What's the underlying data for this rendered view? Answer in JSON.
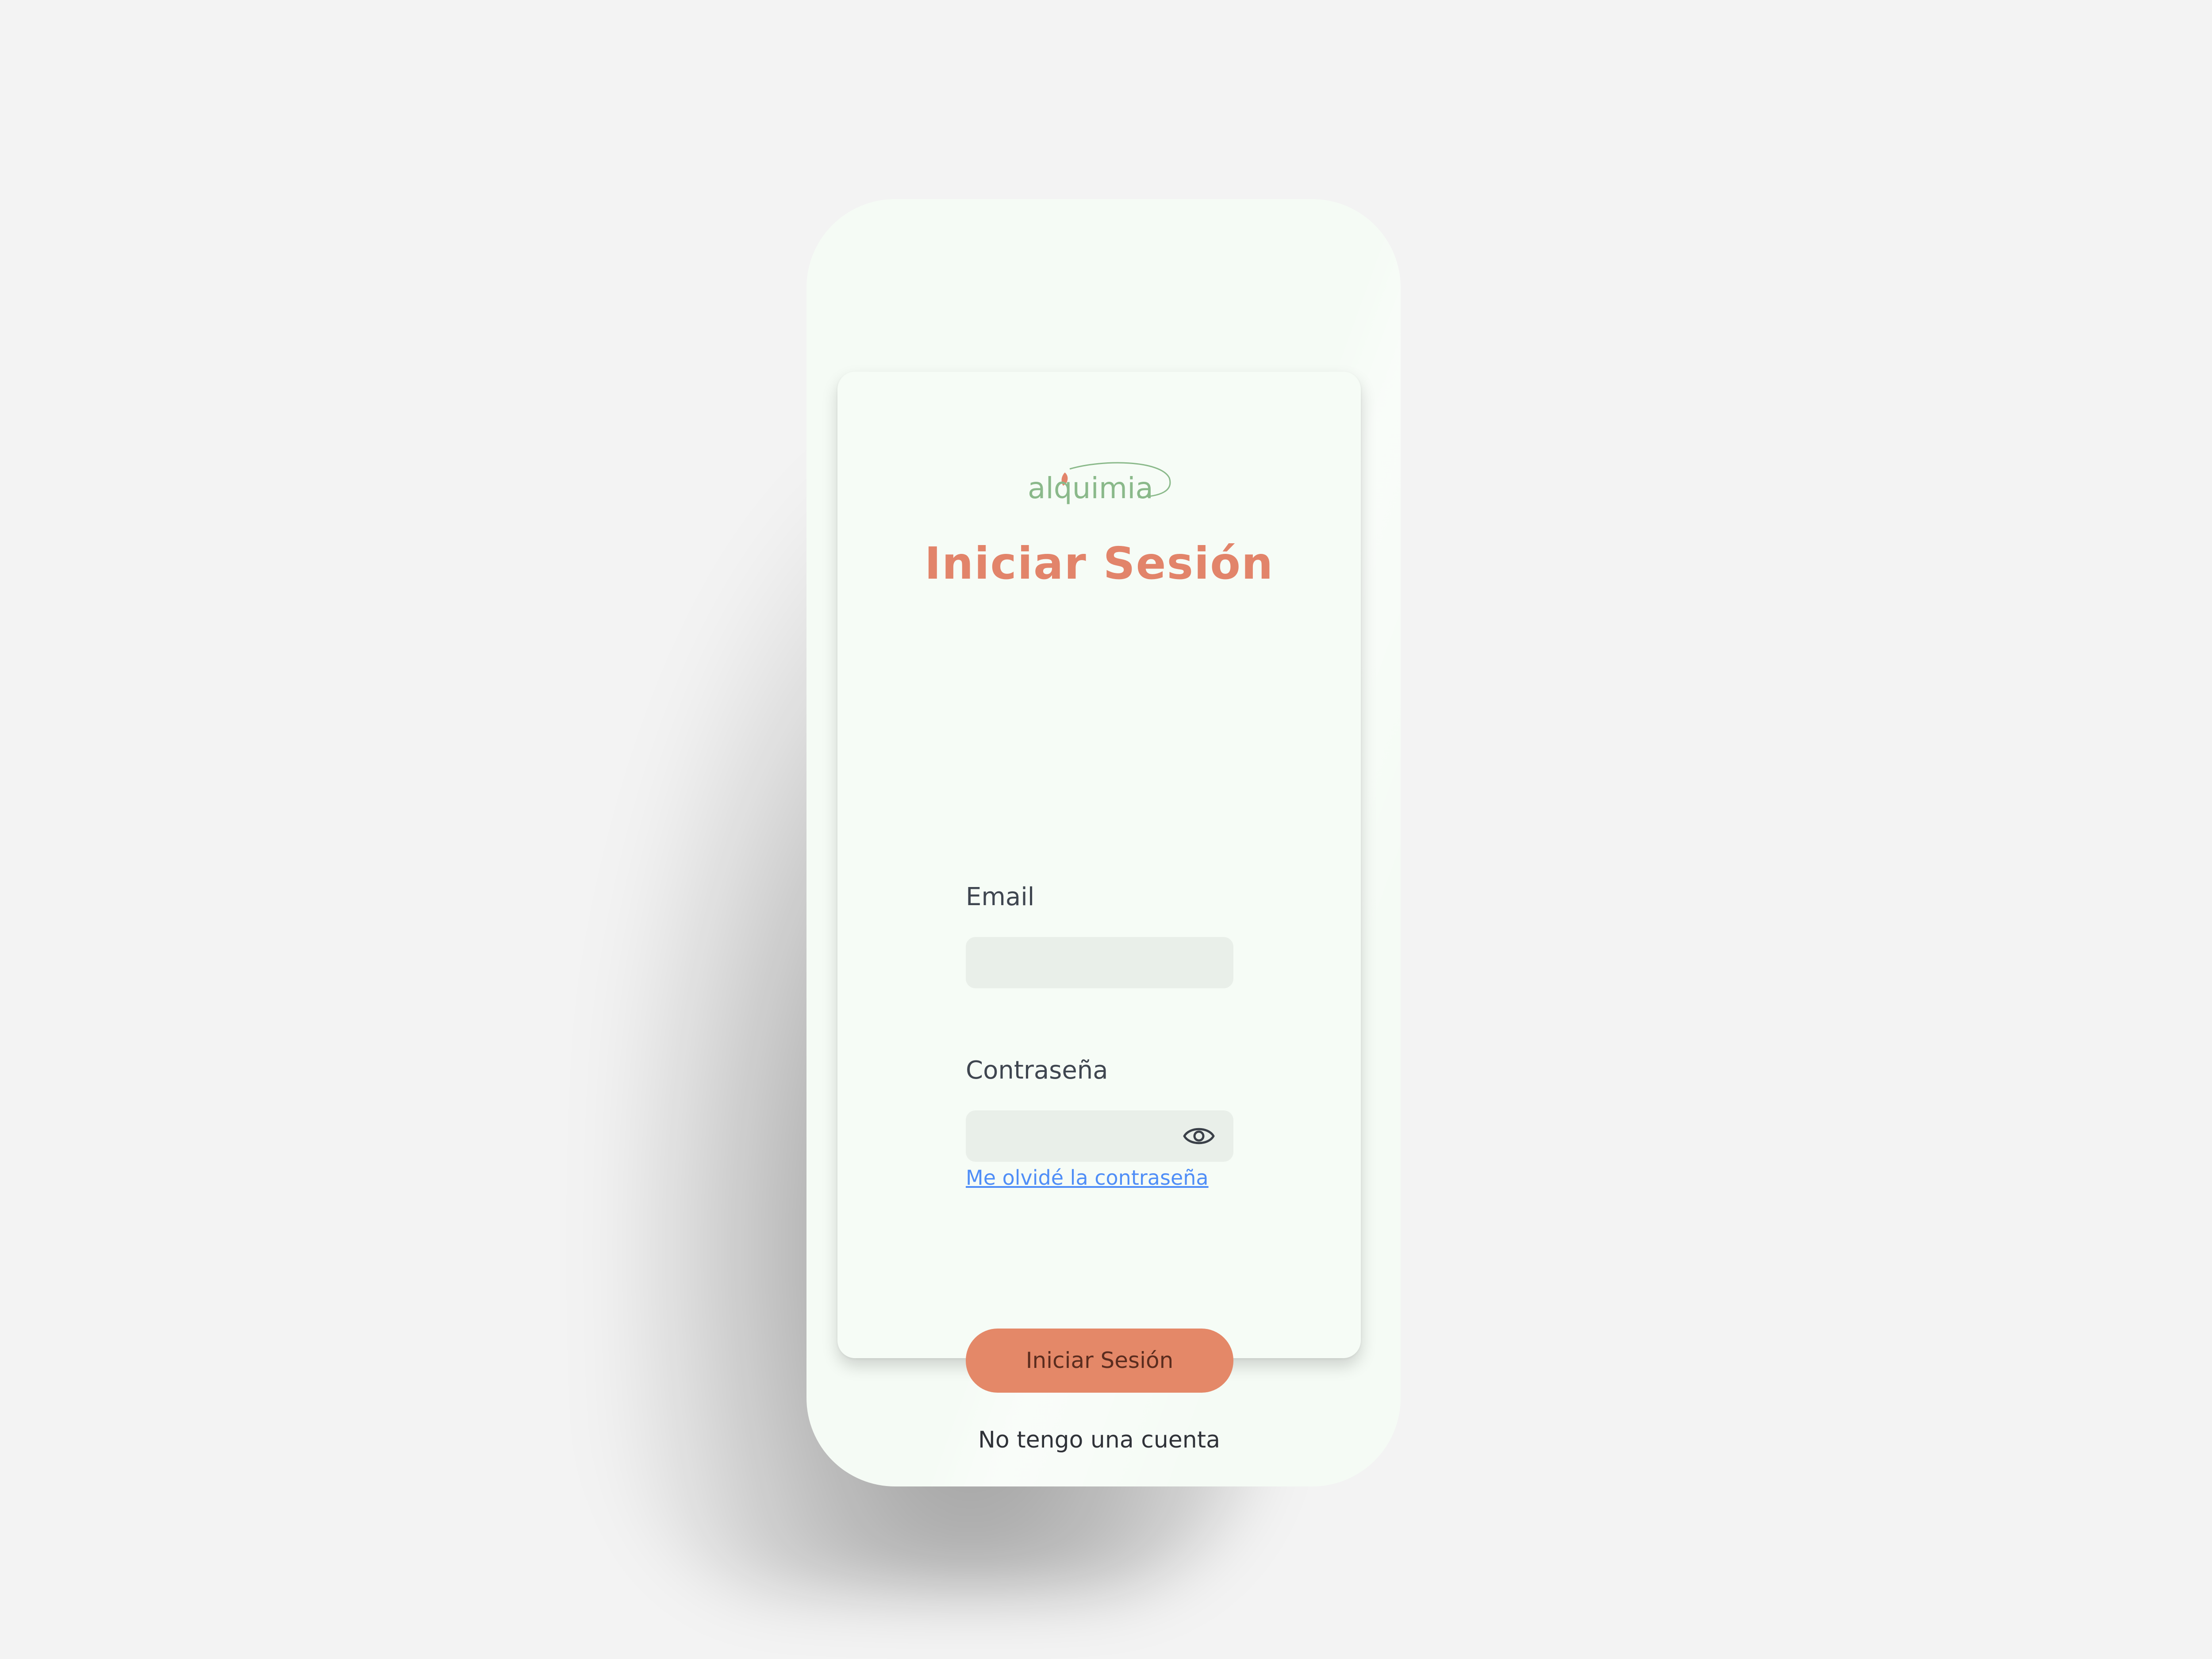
{
  "brand": {
    "logo_text": "alquimia",
    "logo_color": "#8ab98a"
  },
  "login": {
    "title": "Iniciar Sesión",
    "email_label": "Email",
    "email_value": "",
    "password_label": "Contraseña",
    "password_value": "",
    "show_password_icon": "eye-icon",
    "forgot_link": "Me olvidé la contraseña",
    "submit_label": "Iniciar Sesión",
    "signup_link": "No tengo una cuenta"
  },
  "colors": {
    "accent": "#e48868",
    "title": "#e2846a",
    "link": "#4f8ef7",
    "background": "#f3f3f3",
    "card": "#f6fcf6",
    "input": "#e9efe9"
  }
}
